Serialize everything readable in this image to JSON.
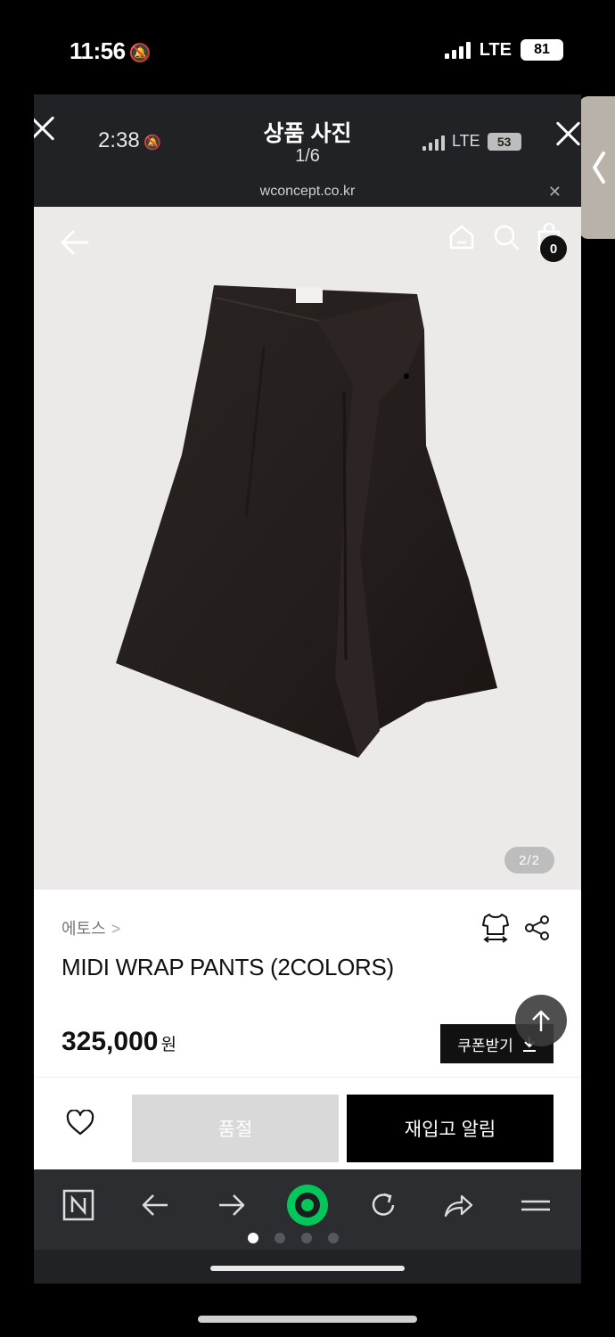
{
  "outer_status": {
    "time": "11:56",
    "network": "LTE",
    "battery": "81"
  },
  "viewer": {
    "time": "2:38",
    "title": "상품 사진",
    "count": "1/6",
    "network": "LTE",
    "battery": "53",
    "url": "wconcept.co.kr"
  },
  "page": {
    "cart_count": "0",
    "photo_indicator": "2/2",
    "brand": "에토스",
    "product_name": "MIDI WRAP PANTS (2COLORS)",
    "price": "325,000",
    "currency": "원",
    "coupon_label": "쿠폰받기",
    "soldout_label": "품절",
    "restock_label": "재입고 알림"
  },
  "toolbar": {
    "icons": [
      "naver-icon",
      "back-arrow-icon",
      "forward-arrow-icon",
      "green-dot-icon",
      "refresh-icon",
      "share-icon",
      "menu-icon"
    ],
    "page_dots": 4,
    "active_dot": 0
  },
  "colors": {
    "accent_green": "#03c75a",
    "dark": "#202226",
    "photo_bg": "#ebeae8"
  }
}
